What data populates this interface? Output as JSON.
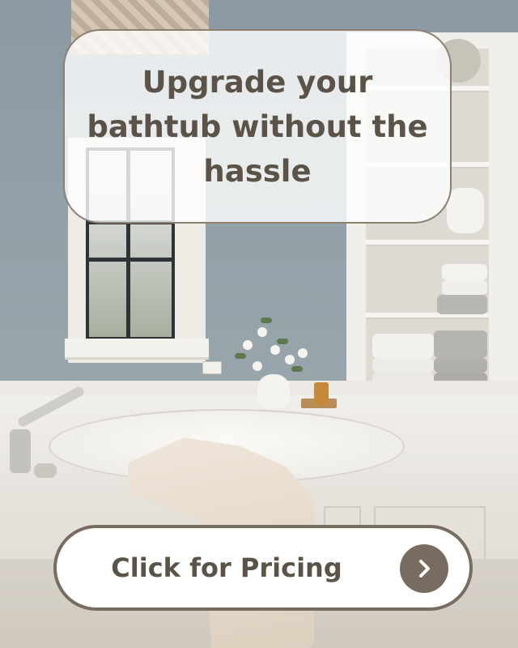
{
  "headline": {
    "text": "Upgrade your bathtub without the hassle"
  },
  "cta": {
    "label": "Click for Pricing",
    "icon": "chevron-right-icon"
  },
  "colors": {
    "text": "#5c5348",
    "button_border": "#776c5f",
    "card_border": "#8b7f70"
  }
}
